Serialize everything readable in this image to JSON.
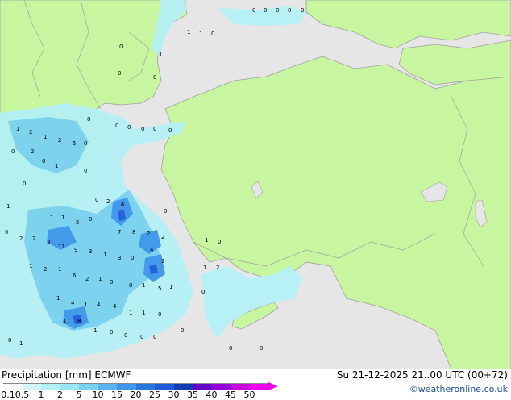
{
  "map": {
    "land_color": "#c8f5a0",
    "sea_color": "#e6e6e6",
    "border_color": "#a0a0a0",
    "precip_light": "#b4f0f5",
    "precip_mid": "#78d2f0",
    "precip_heavy": "#3c96eb",
    "precip_core": "#1e5adc",
    "grid_values": [
      {
        "v": "0",
        "c": "map"
      },
      {
        "v": "1",
        "c": "map"
      },
      {
        "v": "2",
        "c": "map"
      },
      {
        "v": "3",
        "c": "map"
      },
      {
        "v": "4",
        "c": "map"
      },
      {
        "v": "5",
        "c": "map"
      },
      {
        "v": "6",
        "c": "map"
      },
      {
        "v": "7",
        "c": "map"
      },
      {
        "v": "8",
        "c": "map"
      },
      {
        "v": "9",
        "c": "map"
      },
      {
        "v": "11",
        "c": "map"
      }
    ]
  },
  "footer": {
    "title_left": "Precipitation [mm] ECMWF",
    "title_right": "Su 21-12-2025 21..00 UTC (00+72)",
    "credit": "©weatheronline.co.uk",
    "scale_labels": [
      "0.1",
      "0.5",
      "1",
      "2",
      "5",
      "10",
      "15",
      "20",
      "25",
      "30",
      "35",
      "40",
      "45",
      "50"
    ],
    "scale_colors": [
      "#ffffff",
      "#d2f5fa",
      "#b4f0f5",
      "#96e6f5",
      "#78d2f0",
      "#5ab4ee",
      "#3c96eb",
      "#2878dc",
      "#1e5adc",
      "#143cb4",
      "#6400c8",
      "#9600dc",
      "#c800dc",
      "#f000f0"
    ]
  }
}
